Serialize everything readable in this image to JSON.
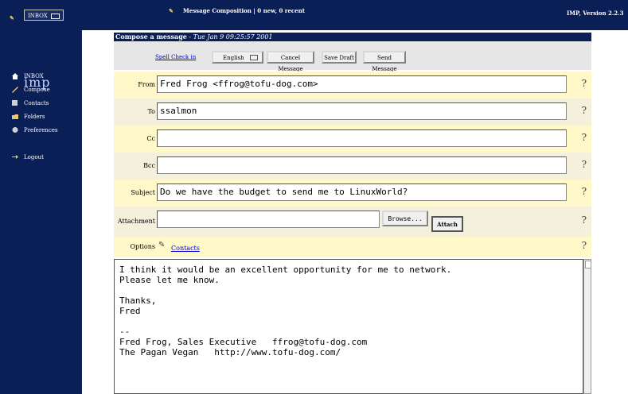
{
  "top": {
    "mailbox_select": "INBOX",
    "status": "Message Composition | 0 new, 0 recent",
    "version": "IMP, Version 2.2.3"
  },
  "sidebar": {
    "logo": "imp",
    "items": [
      {
        "label": "INBOX",
        "icon": "home-icon"
      },
      {
        "label": "Compose",
        "icon": "compose-icon"
      },
      {
        "label": "Contacts",
        "icon": "contacts-icon"
      },
      {
        "label": "Folders",
        "icon": "folders-icon"
      },
      {
        "label": "Preferences",
        "icon": "preferences-icon"
      }
    ],
    "logout": "Logout"
  },
  "compose": {
    "title": "Compose a message",
    "date": "- Tue Jan 9 09:25:57 2001",
    "spell_check": "Spell Check in",
    "language": "English",
    "cancel": "Cancel Message",
    "save_draft": "Save Draft",
    "send": "Send Message",
    "from_label": "From",
    "from_value": "Fred Frog <ffrog@tofu-dog.com>",
    "to_label": "To",
    "to_value": "ssalmon",
    "cc_label": "Cc",
    "cc_value": "",
    "bcc_label": "Bcc",
    "bcc_value": "",
    "subject_label": "Subject",
    "subject_value": "Do we have the budget to send me to LinuxWorld?",
    "attachment_label": "Attachment",
    "browse": "Browse...",
    "attach": "Attach",
    "options_label": "Options",
    "contacts_link": "Contacts",
    "help": "?",
    "body": "I think it would be an excellent opportunity for me to network.\nPlease let me know.\n\nThanks,\nFred\n\n--\nFred Frog, Sales Executive   ffrog@tofu-dog.com\nThe Pagan Vegan   http://www.tofu-dog.com/"
  }
}
